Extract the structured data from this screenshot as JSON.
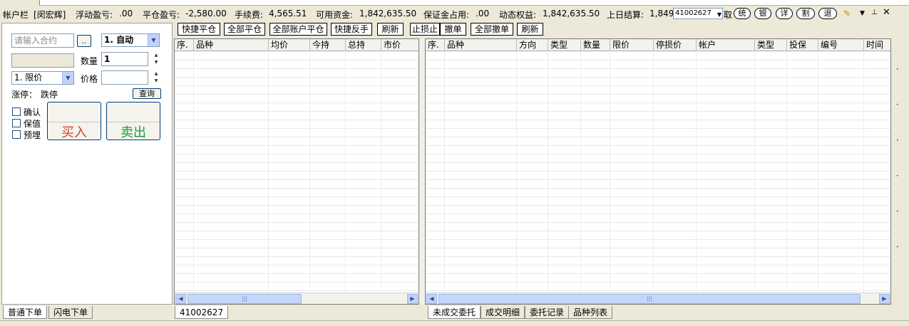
{
  "account_bar": {
    "title": "帐户栏",
    "user": "[闵宏辉]",
    "floating_pl_label": "浮动盈亏:",
    "floating_pl": ".00",
    "close_pl_label": "平仓盈亏:",
    "close_pl": "-2,580.00",
    "fee_label": "手续费:",
    "fee": "4,565.51",
    "available_label": "可用资金:",
    "available": "1,842,635.50",
    "margin_label": "保证金占用:",
    "margin": ".00",
    "equity_label": "动态权益:",
    "equity": "1,842,635.50",
    "prev_settle_label": "上日结算:",
    "prev_settle": "1,849",
    "account_select": "41002627",
    "fetch_label": "取",
    "buttons": [
      "统",
      "银",
      "详",
      "割",
      "退"
    ],
    "icons": [
      "wand-icon",
      "dropdown-icon",
      "pin-icon",
      "close-icon"
    ]
  },
  "order_panel": {
    "contract_placeholder": "请输入合约",
    "browse_label": "..",
    "mode_select": "1. 自动",
    "qty_label": "数量",
    "qty_value": "1",
    "order_type_select": "1. 限价",
    "price_label": "价格",
    "price_value": "",
    "limit_up_label": "涨停：",
    "limit_down_label": "跌停",
    "query_label": "查询",
    "confirm_label": "确认",
    "keep_value_label": "保值",
    "preset_label": "预埋",
    "buy_label": "买入",
    "sell_label": "卖出",
    "buy_color": "#e03a2a",
    "sell_color": "#1f9a3a"
  },
  "positions": {
    "toolbar": [
      "快捷平仓",
      "全部平仓",
      "全部账户平仓",
      "快捷反手",
      "刷新"
    ],
    "columns": [
      "序.",
      "品种",
      "均价",
      "今持",
      "总持",
      "市价"
    ],
    "account_tab": "41002627"
  },
  "orders": {
    "toolbar": [
      "止损止",
      "撤单",
      "全部撤单",
      "刷新"
    ],
    "columns": [
      "序.",
      "品种",
      "方向",
      "类型",
      "数量",
      "限价",
      "停损价",
      "帐户",
      "类型",
      "投保",
      "编号",
      "时间"
    ]
  },
  "bottom_tabs_left": [
    "普通下单",
    "闪电下单"
  ],
  "bottom_tabs_right": [
    "未成交委托",
    "成交明细",
    "委托记录",
    "品种列表"
  ]
}
